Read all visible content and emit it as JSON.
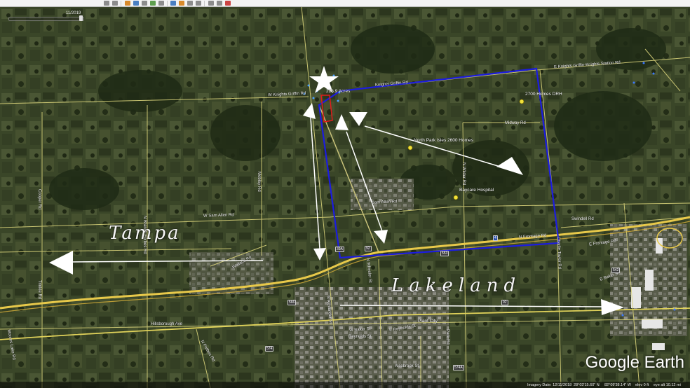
{
  "toolbar": {
    "buttons": [
      "nav-icon",
      "sidebar-toggle-icon",
      "placemark-icon",
      "polygon-icon",
      "path-icon",
      "overlay-icon",
      "tour-icon",
      "history-icon",
      "sun-icon",
      "planets-icon",
      "ruler-icon",
      "email-icon",
      "print-icon",
      "maps-icon"
    ]
  },
  "time_slider": {
    "date": "11/2019"
  },
  "roads": {
    "knights_griffin_w": "W Knights Griffin Rd",
    "knights_griffin_e": "Knights Griffin Rd",
    "knights_griffin_station": "E Knights Griffin-Knights Station Rd",
    "midway": "Midway Rd",
    "sam_allen_w": "W Sam Allen Rd",
    "sam_allen": "Sam Allen Rd",
    "frontage": "N Frontage Rd",
    "e_frontage": "E Frontage Rd",
    "swindell": "Swindell Rd",
    "cooper": "Cooper Rd",
    "trinkle": "Trinkle Rd",
    "branch_forbes": "N Branch Forbes Rd",
    "wilder": "N Wilder Rd",
    "hillsborough": "Hillsborough Ave",
    "baker": "W Baker St",
    "e_baker": "E Baker St",
    "reynolds": "Reynolds St",
    "e_reynolds": "E Reynolds St",
    "plant_city": "Plant City",
    "alsobrook": "Alsobrook St",
    "park": "Park Rd",
    "charlie_taylor": "Charlie Taylor Rd",
    "wheeler": "N Wheeler St",
    "alexander": "N Alexander St",
    "wallace": "Wallace Rd",
    "moores_lake": "Moores Lake Rd",
    "forbes": "N Forbes Rd",
    "mobley": "Mobley Rd"
  },
  "shields": {
    "i4": "4",
    "us92": "92",
    "sr39": "39A",
    "r566": "566",
    "r574": "574",
    "r553": "553",
    "r92b": "92",
    "r542": "542",
    "r574a": "574A"
  },
  "placemarks": {
    "acres": "226.9 Acres",
    "dr_horton": "2700 Homes DRH",
    "north_park": "North Park Isles 2600 Homes",
    "baycare": "Baycare Hospital"
  },
  "annotations": {
    "tampa": "Tampa",
    "lakeland": "Lakeland"
  },
  "branding": {
    "logo": "Google Earth"
  },
  "status": {
    "imagery_date": "Imagery Date: 12/11/2018",
    "lat": "28°03'15.60\" N",
    "lon": "82°09'38.14\" W",
    "elev": "elev 0 ft",
    "eye_alt": "eye alt 10.12 mi"
  },
  "colors": {
    "boundary": "#1c1ce0",
    "parcel": "#e01c1c",
    "roads": "#e8e07a",
    "interstate": "#e8c94a",
    "arrows": "#ffffff"
  }
}
